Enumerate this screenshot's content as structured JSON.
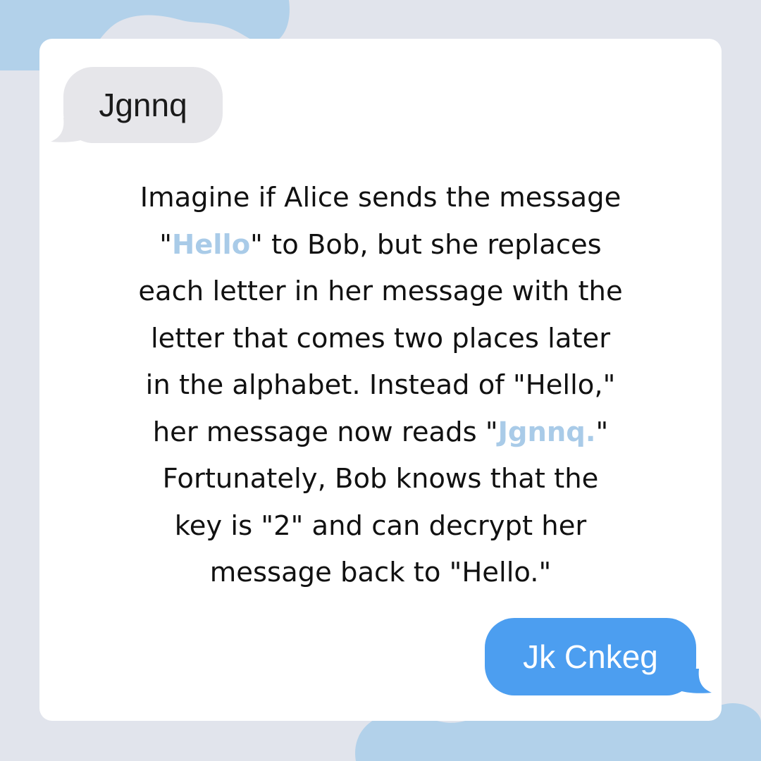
{
  "colors": {
    "background": "#e1e4ec",
    "card": "#ffffff",
    "blob": "#b2d1ea",
    "incoming_bubble": "#e6e6ea",
    "outgoing_bubble": "#4c9ef0",
    "highlight": "#a9cbe8"
  },
  "incoming_message": {
    "text": "Jgnnq"
  },
  "outgoing_message": {
    "text": "Jk Cnkeg"
  },
  "body": {
    "line1": "Imagine if Alice sends the message",
    "line2_pre": "\"",
    "line2_highlight": "Hello",
    "line2_post": "\" to Bob, but she replaces",
    "line3": "each letter in her message with the",
    "line4": "letter that comes two places later",
    "line5": "in the alphabet. Instead of \"Hello,\"",
    "line6_pre": "her message now reads \"",
    "line6_highlight": "Jgnnq.",
    "line6_post": "\"",
    "line7": "Fortunately, Bob knows that the",
    "line8": "key is \"2\" and can decrypt her",
    "line9": "message back to \"Hello.\""
  }
}
